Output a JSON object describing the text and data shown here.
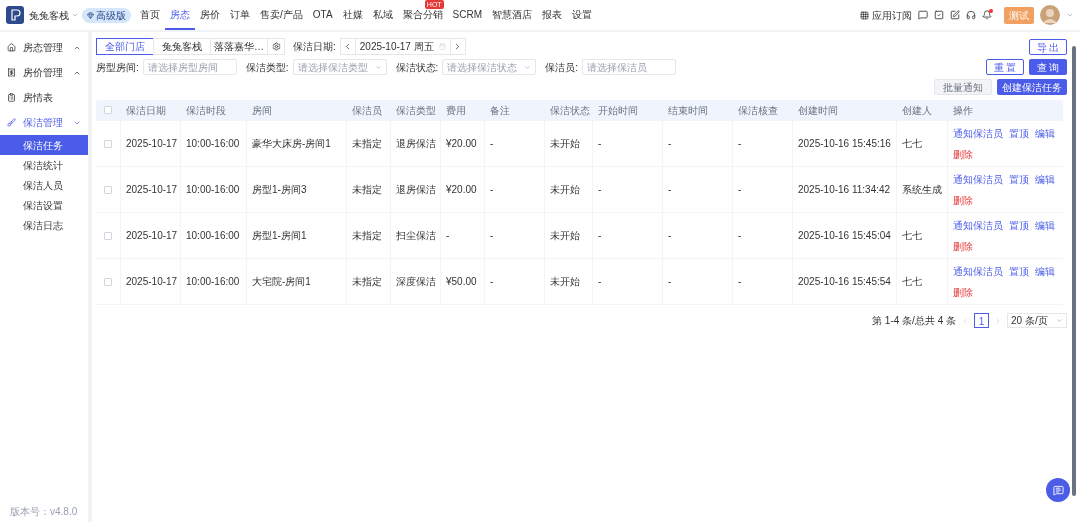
{
  "header": {
    "store": "兔兔客栈",
    "badge": "高级版",
    "nav": [
      {
        "label": "首页",
        "selected": false
      },
      {
        "label": "房态",
        "selected": true
      },
      {
        "label": "房价",
        "selected": false
      },
      {
        "label": "订单",
        "selected": false
      },
      {
        "label": "售卖/产品",
        "selected": false
      },
      {
        "label": "OTA",
        "selected": false
      },
      {
        "label": "社媒",
        "selected": false
      },
      {
        "label": "私域",
        "selected": false
      },
      {
        "label": "聚合分销",
        "selected": false,
        "tag": "HOT"
      },
      {
        "label": "SCRM",
        "selected": false
      },
      {
        "label": "智慧酒店",
        "selected": false
      },
      {
        "label": "报表",
        "selected": false
      },
      {
        "label": "设置",
        "selected": false
      }
    ],
    "app_subscribe": "应用订阅",
    "test_badge": "测试",
    "notification": true
  },
  "sidebar": {
    "items": [
      {
        "label": "房态管理",
        "expanded": false,
        "selected": false
      },
      {
        "label": "房价管理",
        "expanded": false,
        "selected": false
      },
      {
        "label": "房情表",
        "selected": false
      },
      {
        "label": "保洁管理",
        "expanded": true,
        "selected": true,
        "children": [
          {
            "label": "保洁任务",
            "selected": true
          },
          {
            "label": "保洁统计",
            "selected": false
          },
          {
            "label": "保洁人员",
            "selected": false
          },
          {
            "label": "保洁设置",
            "selected": false
          },
          {
            "label": "保洁日志",
            "selected": false
          }
        ]
      }
    ],
    "version": "版本号：v4.8.0"
  },
  "store_tabs": [
    {
      "label": "全部门店",
      "selected": true
    },
    {
      "label": "兔兔客栈",
      "selected": false
    },
    {
      "label": "落落嘉华…",
      "selected": false
    }
  ],
  "date_filter": {
    "label": "保洁日期:",
    "value": "2025-10-17 周五"
  },
  "export_button": "导 出",
  "filters": [
    {
      "label": "房型房间:",
      "placeholder": "请选择房型房间",
      "dropdown": false
    },
    {
      "label": "保洁类型:",
      "placeholder": "请选择保洁类型",
      "dropdown": true
    },
    {
      "label": "保洁状态:",
      "placeholder": "请选择保洁状态",
      "dropdown": true
    },
    {
      "label": "保洁员:",
      "placeholder": "请选择保洁员",
      "dropdown": false
    }
  ],
  "reset_button": "重 置",
  "query_button": "查 询",
  "batch_button": {
    "label": "批量通知",
    "disabled": true
  },
  "create_button": "创建保洁任务",
  "table": {
    "all_checked": false,
    "columns": [
      "保洁日期",
      "保洁时段",
      "房间",
      "保洁员",
      "保洁类型",
      "费用",
      "备注",
      "保洁状态",
      "开始时间",
      "结束时间",
      "保洁核查",
      "创建时间",
      "创建人",
      "操作"
    ],
    "rows": [
      {
        "checked": false,
        "cells": [
          "2025-10-17",
          "10:00-16:00",
          "豪华大床房-房间1",
          "未指定",
          "退房保洁",
          "¥20.00",
          "-",
          "未开始",
          "-",
          "-",
          "-",
          "2025-10-16 15:45:16",
          "七七"
        ],
        "actions": [
          "通知保洁员",
          "置顶",
          "编辑"
        ],
        "delete": "删除"
      },
      {
        "checked": false,
        "cells": [
          "2025-10-17",
          "10:00-16:00",
          "房型1-房间3",
          "未指定",
          "退房保洁",
          "¥20.00",
          "-",
          "未开始",
          "-",
          "-",
          "-",
          "2025-10-16 11:34:42",
          "系统生成"
        ],
        "actions": [
          "通知保洁员",
          "置顶",
          "编辑"
        ],
        "delete": "删除"
      },
      {
        "checked": false,
        "cells": [
          "2025-10-17",
          "10:00-16:00",
          "房型1-房间1",
          "未指定",
          "扫尘保洁",
          "-",
          "-",
          "未开始",
          "-",
          "-",
          "-",
          "2025-10-16 15:45:04",
          "七七"
        ],
        "actions": [
          "通知保洁员",
          "置顶",
          "编辑"
        ],
        "delete": "删除"
      },
      {
        "checked": false,
        "cells": [
          "2025-10-17",
          "10:00-16:00",
          "大宅院-房间1",
          "未指定",
          "深度保洁",
          "¥50.00",
          "-",
          "未开始",
          "-",
          "-",
          "-",
          "2025-10-16 15:45:54",
          "七七"
        ],
        "actions": [
          "通知保洁员",
          "置顶",
          "编辑"
        ],
        "delete": "删除"
      }
    ]
  },
  "pagination": {
    "summary": "第 1-4 条/总共 4 条",
    "pages": [
      {
        "label": "1",
        "selected": true
      }
    ],
    "page_size": "20 条/页"
  }
}
